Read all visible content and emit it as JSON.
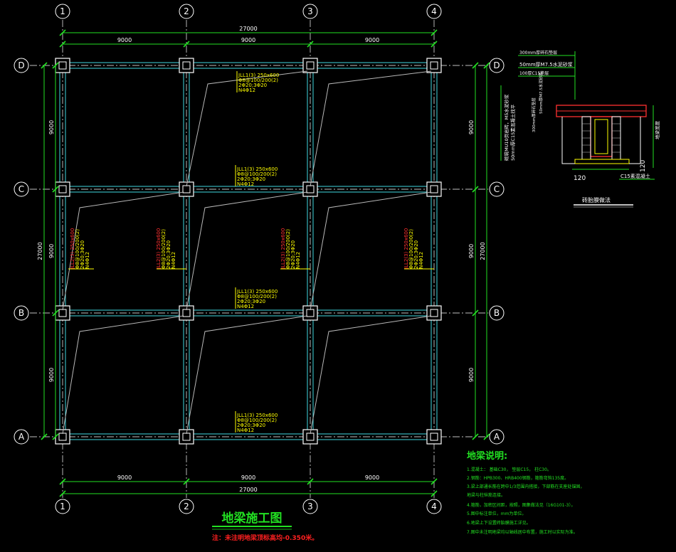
{
  "title": "地梁施工图",
  "note": "注：未注明地梁顶标高均-0.350米。",
  "grid": {
    "columns": [
      "1",
      "2",
      "3",
      "4"
    ],
    "rows": [
      "D",
      "C",
      "B",
      "A"
    ]
  },
  "dims": {
    "span": "9000",
    "total": "27000"
  },
  "beam_tags": {
    "horizontal": [
      [
        "JLL1(3) 250x600",
        "Φ8@100/200(2)",
        "2Φ20;3Φ20",
        "N4Φ12"
      ],
      [
        "JLL1(3) 250x600",
        "Φ8@100/200(2)",
        "2Φ20;3Φ20",
        "N4Φ12"
      ],
      [
        "JLL1(3) 250x600",
        "Φ8@100/200(2)",
        "2Φ20;3Φ20",
        "N4Φ12"
      ],
      [
        "JLL1(3) 250x600",
        "Φ8@100/200(2)",
        "2Φ20;3Φ20",
        "N4Φ12"
      ]
    ],
    "vertical": [
      [
        "JLL2(3) 250x600",
        "Φ8@100/200(2)",
        "2Φ20;3Φ20",
        "N4Φ12"
      ],
      [
        "JLL2(3) 250x600",
        "Φ8@100/200(2)",
        "2Φ20;3Φ20",
        "N4Φ12"
      ],
      [
        "JLL2(3) 250x600",
        "Φ8@100/200(2)",
        "2Φ20;3Φ20",
        "N4Φ12"
      ],
      [
        "JLL2(3) 250x600",
        "Φ8@100/200(2)",
        "2Φ20;3Φ20",
        "N4Φ12"
      ]
    ]
  },
  "detail": {
    "legend": [
      "300mm厚碎石垫层",
      "50mm厚M7.5水泥砂浆",
      "100厚C15垫层"
    ],
    "side_labels": [
      "砌筑MU10页岩砖，M5水泥砂浆",
      "50mm厚C15素混凝土找平"
    ],
    "right_label": "地梁宽度",
    "dims": [
      "120",
      "120"
    ],
    "bottom_label": "C15素混凝土",
    "caption": "砖胎膜做法"
  },
  "notes": {
    "heading": "地梁说明:",
    "items": [
      "1.混凝土：  基础C30，  垫层C15，  柱C30。",
      "2.钢筋：HPB300、HRB400钢筋，箍筋弯钩135度。",
      "3.梁上部通长筋在跨中1/3范围内搭接，下部筋在支座处锚固，",
      "  地梁与柱纵筋连接。",
      "4.箍筋，加密区间距，按照，图集做法见（16G101-3）。",
      "5.图中标注单位，mm为单位。",
      "6.地梁上下设置砖胎膜施工详见。",
      "7.图中未注明地梁均以轴线居中布置，施工时以实际为准。"
    ]
  }
}
